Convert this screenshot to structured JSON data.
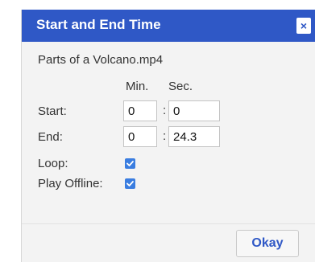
{
  "dialog": {
    "title": "Start and End Time",
    "close_label": "×",
    "filename": "Parts of a Volcano.mp4",
    "columns": {
      "min": "Min.",
      "sec": "Sec."
    },
    "start": {
      "label": "Start:",
      "min": "0",
      "sec": "0"
    },
    "end": {
      "label": "End:",
      "min": "0",
      "sec": "24.3"
    },
    "separator": ":",
    "loop": {
      "label": "Loop:",
      "checked": true
    },
    "play_offline": {
      "label": "Play Offline:",
      "checked": true
    },
    "okay_label": "Okay"
  },
  "colors": {
    "accent": "#2f58c6",
    "checkbox": "#3a7de0"
  }
}
